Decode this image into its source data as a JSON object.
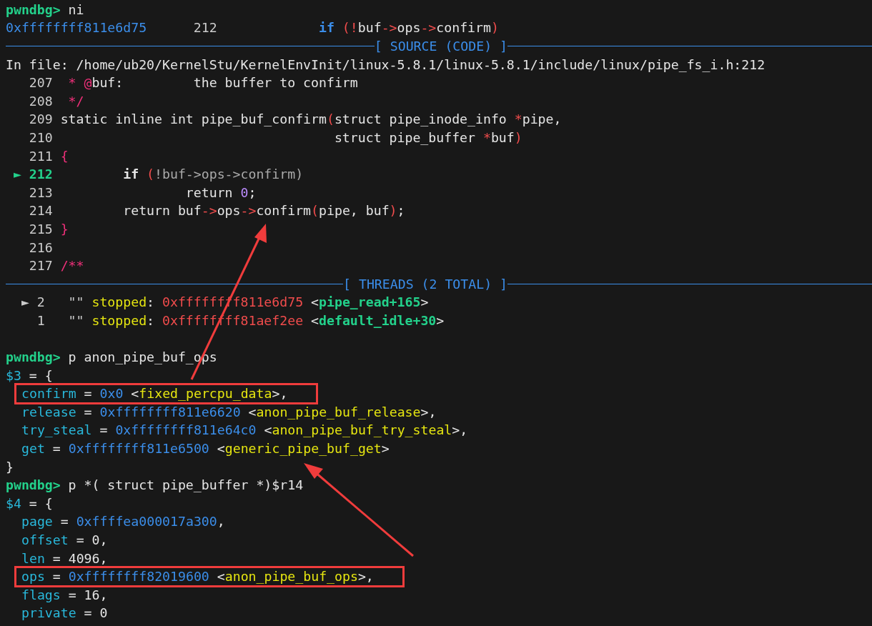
{
  "terminal": {
    "lines": [
      {
        "kind": "code",
        "segments": [
          {
            "kind": "prompt",
            "text": "pwndbg> "
          },
          {
            "kind": "text",
            "text": "ni"
          }
        ]
      },
      {
        "kind": "code",
        "segments": [
          {
            "kind": "addr",
            "text": "0xffffffff811e6d75"
          },
          {
            "kind": "lineno",
            "text": "      212             "
          },
          {
            "kind": "keyword",
            "text": "if"
          },
          {
            "kind": "punct",
            "text": " (!"
          },
          {
            "kind": "text",
            "text": "buf"
          },
          {
            "kind": "punct",
            "text": "->"
          },
          {
            "kind": "text",
            "text": "ops"
          },
          {
            "kind": "punct",
            "text": "->"
          },
          {
            "kind": "text",
            "text": "confirm"
          },
          {
            "kind": "punct",
            "text": ")"
          }
        ]
      },
      {
        "kind": "divider",
        "title": "[ SOURCE (CODE) ]"
      },
      {
        "kind": "code",
        "segments": [
          {
            "kind": "text",
            "text": "In file: /home/ub20/KernelStu/KernelEnvInit/linux-5.8.1/linux-5.8.1/include/linux/pipe_fs_i.h:212"
          }
        ]
      },
      {
        "kind": "code",
        "segments": [
          {
            "kind": "lineno",
            "text": "   207"
          },
          {
            "kind": "comment",
            "text": "  * @"
          },
          {
            "kind": "text",
            "text": "buf:         the buffer to confirm"
          }
        ]
      },
      {
        "kind": "code",
        "segments": [
          {
            "kind": "lineno",
            "text": "   208"
          },
          {
            "kind": "comment",
            "text": "  */"
          }
        ]
      },
      {
        "kind": "code",
        "segments": [
          {
            "kind": "lineno",
            "text": "   209"
          },
          {
            "kind": "text",
            "text": " static inline int pipe_buf_confirm"
          },
          {
            "kind": "punct",
            "text": "("
          },
          {
            "kind": "text",
            "text": "struct pipe_inode_info "
          },
          {
            "kind": "punct",
            "text": "*"
          },
          {
            "kind": "text",
            "text": "pipe,"
          }
        ]
      },
      {
        "kind": "code",
        "segments": [
          {
            "kind": "lineno",
            "text": "   210"
          },
          {
            "kind": "text",
            "text": "                                    struct pipe_buffer "
          },
          {
            "kind": "punct",
            "text": "*"
          },
          {
            "kind": "text",
            "text": "buf"
          },
          {
            "kind": "punct",
            "text": ")"
          }
        ]
      },
      {
        "kind": "code",
        "segments": [
          {
            "kind": "lineno",
            "text": "   211"
          },
          {
            "kind": "comment",
            "text": " {"
          }
        ]
      },
      {
        "kind": "code",
        "segments": [
          {
            "kind": "marker",
            "text": " ► 212"
          },
          {
            "kind": "bold",
            "text": "         if"
          },
          {
            "kind": "punct",
            "text": " ("
          },
          {
            "kind": "dim",
            "text": "!buf->ops->confirm)"
          }
        ]
      },
      {
        "kind": "code",
        "segments": [
          {
            "kind": "lineno",
            "text": "   213"
          },
          {
            "kind": "text",
            "text": "                 return "
          },
          {
            "kind": "number",
            "text": "0"
          },
          {
            "kind": "text",
            "text": ";"
          }
        ]
      },
      {
        "kind": "code",
        "segments": [
          {
            "kind": "lineno",
            "text": "   214"
          },
          {
            "kind": "text",
            "text": "         return buf"
          },
          {
            "kind": "punct",
            "text": "->"
          },
          {
            "kind": "text",
            "text": "ops"
          },
          {
            "kind": "punct",
            "text": "->"
          },
          {
            "kind": "text",
            "text": "confirm"
          },
          {
            "kind": "punct",
            "text": "("
          },
          {
            "kind": "text",
            "text": "pipe, buf"
          },
          {
            "kind": "punct",
            "text": ")"
          },
          {
            "kind": "text",
            "text": ";"
          }
        ]
      },
      {
        "kind": "code",
        "segments": [
          {
            "kind": "lineno",
            "text": "   215"
          },
          {
            "kind": "comment",
            "text": " }"
          }
        ]
      },
      {
        "kind": "code",
        "segments": [
          {
            "kind": "lineno",
            "text": "   216"
          }
        ]
      },
      {
        "kind": "code",
        "segments": [
          {
            "kind": "lineno",
            "text": "   217"
          },
          {
            "kind": "comment",
            "text": " /**"
          }
        ]
      },
      {
        "kind": "divider",
        "title": "[ THREADS (2 TOTAL) ]"
      },
      {
        "kind": "code",
        "segments": [
          {
            "kind": "lineno",
            "text": "  ► 2   \"\" "
          },
          {
            "kind": "status",
            "text": "stopped"
          },
          {
            "kind": "text",
            "text": ": "
          },
          {
            "kind": "taddr",
            "text": "0xffffffff811e6d75"
          },
          {
            "kind": "text",
            "text": " <"
          },
          {
            "kind": "tfunc",
            "text": "pipe_read+165"
          },
          {
            "kind": "text",
            "text": ">"
          }
        ]
      },
      {
        "kind": "code",
        "segments": [
          {
            "kind": "lineno",
            "text": "    1   \"\" "
          },
          {
            "kind": "status",
            "text": "stopped"
          },
          {
            "kind": "text",
            "text": ": "
          },
          {
            "kind": "taddr",
            "text": "0xffffffff81aef2ee"
          },
          {
            "kind": "text",
            "text": " <"
          },
          {
            "kind": "tfunc",
            "text": "default_idle+30"
          },
          {
            "kind": "text",
            "text": ">"
          }
        ]
      },
      {
        "kind": "blank"
      },
      {
        "kind": "code",
        "segments": [
          {
            "kind": "prompt",
            "text": "pwndbg> "
          },
          {
            "kind": "text",
            "text": "p anon_pipe_buf_ops"
          }
        ]
      },
      {
        "kind": "code",
        "segments": [
          {
            "kind": "field",
            "text": "$3"
          },
          {
            "kind": "text",
            "text": " = {"
          }
        ]
      },
      {
        "kind": "member",
        "highlighted": true,
        "segments": [
          {
            "kind": "field",
            "text": "confirm"
          },
          {
            "kind": "text",
            "text": " = "
          },
          {
            "kind": "value",
            "text": "0x0"
          },
          {
            "kind": "text",
            "text": " <"
          },
          {
            "kind": "symbol",
            "text": "fixed_percpu_data"
          },
          {
            "kind": "text",
            "text": ">,"
          }
        ]
      },
      {
        "kind": "member",
        "highlighted": false,
        "segments": [
          {
            "kind": "field",
            "text": "release"
          },
          {
            "kind": "text",
            "text": " = "
          },
          {
            "kind": "value",
            "text": "0xffffffff811e6620"
          },
          {
            "kind": "text",
            "text": " <"
          },
          {
            "kind": "symbol",
            "text": "anon_pipe_buf_release"
          },
          {
            "kind": "text",
            "text": ">,"
          }
        ]
      },
      {
        "kind": "member",
        "segments": [
          {
            "kind": "field",
            "text": "try_steal"
          },
          {
            "kind": "text",
            "text": " = "
          },
          {
            "kind": "value",
            "text": "0xffffffff811e64c0"
          },
          {
            "kind": "text",
            "text": " <"
          },
          {
            "kind": "symbol",
            "text": "anon_pipe_buf_try_steal"
          },
          {
            "kind": "text",
            "text": ">,"
          }
        ]
      },
      {
        "kind": "member",
        "segments": [
          {
            "kind": "field",
            "text": "get"
          },
          {
            "kind": "text",
            "text": " = "
          },
          {
            "kind": "value",
            "text": "0xffffffff811e6500"
          },
          {
            "kind": "text",
            "text": " <"
          },
          {
            "kind": "symbol",
            "text": "generic_pipe_buf_get"
          },
          {
            "kind": "text",
            "text": ">"
          }
        ]
      },
      {
        "kind": "code",
        "segments": [
          {
            "kind": "text",
            "text": "}"
          }
        ]
      },
      {
        "kind": "code",
        "segments": [
          {
            "kind": "prompt",
            "text": "pwndbg> "
          },
          {
            "kind": "text",
            "text": "p *( struct pipe_buffer *)$r14"
          }
        ]
      },
      {
        "kind": "code",
        "segments": [
          {
            "kind": "field",
            "text": "$4"
          },
          {
            "kind": "text",
            "text": " = {"
          }
        ]
      },
      {
        "kind": "member",
        "segments": [
          {
            "kind": "field",
            "text": "page"
          },
          {
            "kind": "text",
            "text": " = "
          },
          {
            "kind": "value",
            "text": "0xffffea000017a300"
          },
          {
            "kind": "text",
            "text": ","
          }
        ]
      },
      {
        "kind": "member",
        "segments": [
          {
            "kind": "field",
            "text": "offset"
          },
          {
            "kind": "text",
            "text": " = 0,"
          }
        ]
      },
      {
        "kind": "member",
        "segments": [
          {
            "kind": "field",
            "text": "len"
          },
          {
            "kind": "text",
            "text": " = 4096,"
          }
        ]
      },
      {
        "kind": "member",
        "highlighted": true,
        "segments": [
          {
            "kind": "field",
            "text": "ops"
          },
          {
            "kind": "text",
            "text": " = "
          },
          {
            "kind": "value",
            "text": "0xffffffff82019600"
          },
          {
            "kind": "text",
            "text": " <"
          },
          {
            "kind": "symbol",
            "text": "anon_pipe_buf_ops"
          },
          {
            "kind": "text",
            "text": ">,"
          }
        ]
      },
      {
        "kind": "member",
        "segments": [
          {
            "kind": "field",
            "text": "flags"
          },
          {
            "kind": "text",
            "text": " = 16,"
          }
        ]
      },
      {
        "kind": "member",
        "segments": [
          {
            "kind": "field",
            "text": "private"
          },
          {
            "kind": "text",
            "text": " = 0"
          }
        ]
      }
    ]
  }
}
